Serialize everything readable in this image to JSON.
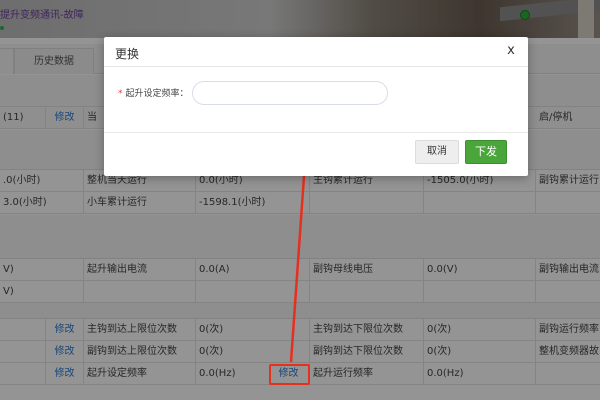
{
  "banner": {
    "title": "提升变频通讯-故障"
  },
  "tabs": {
    "current": "",
    "history": "历史数据"
  },
  "table": {
    "r1": {
      "c1": "(11)",
      "c1_link": "修改",
      "c2": "当",
      "c7": "启/停机"
    },
    "r2": {
      "c1": ".0(小时)",
      "c2": "整机当天运行",
      "c3": "0.0(小时)",
      "c4": "主钩累计运行",
      "c5": "-1505.0(小时)",
      "c6": "副钩累计运行"
    },
    "r3": {
      "c1": "3.0(小时)",
      "c2": "小车累计运行",
      "c3": "-1598.1(小时)"
    },
    "r4": {
      "c1": "V)",
      "c2": "起升输出电流",
      "c3": "0.0(A)",
      "c4": "副钩母线电压",
      "c5": "0.0(V)",
      "c6": "副钩输出电流"
    },
    "r5": {
      "c1": "V)"
    },
    "r6": {
      "c1_link": "修改",
      "c2": "主钩到达上限位次数",
      "c3": "0(次)",
      "c4": "主钩到达下限位次数",
      "c5": "0(次)",
      "c6": "副钩运行频率"
    },
    "r7": {
      "c1_link": "修改",
      "c2": "副钩到达上限位次数",
      "c3": "0(次)",
      "c4": "副钩到达下限位次数",
      "c5": "0(次)",
      "c6": "整机变频器故"
    },
    "r8": {
      "c1_link": "修改",
      "c2": "起升设定频率",
      "c3": "0.0(Hz)",
      "c3_link": "修改",
      "c4": "起升运行频率",
      "c5": "0.0(Hz)"
    }
  },
  "dialog": {
    "title": "更换",
    "close": "x",
    "required_mark": "*",
    "field_label": "起升设定频率：",
    "field_value": "",
    "field_placeholder": "",
    "cancel_label": "取消",
    "send_label": "下发"
  },
  "colors": {
    "accent_green": "#4aa53a",
    "link_blue": "#2a7bd1",
    "annotation_red": "#e5301f"
  }
}
